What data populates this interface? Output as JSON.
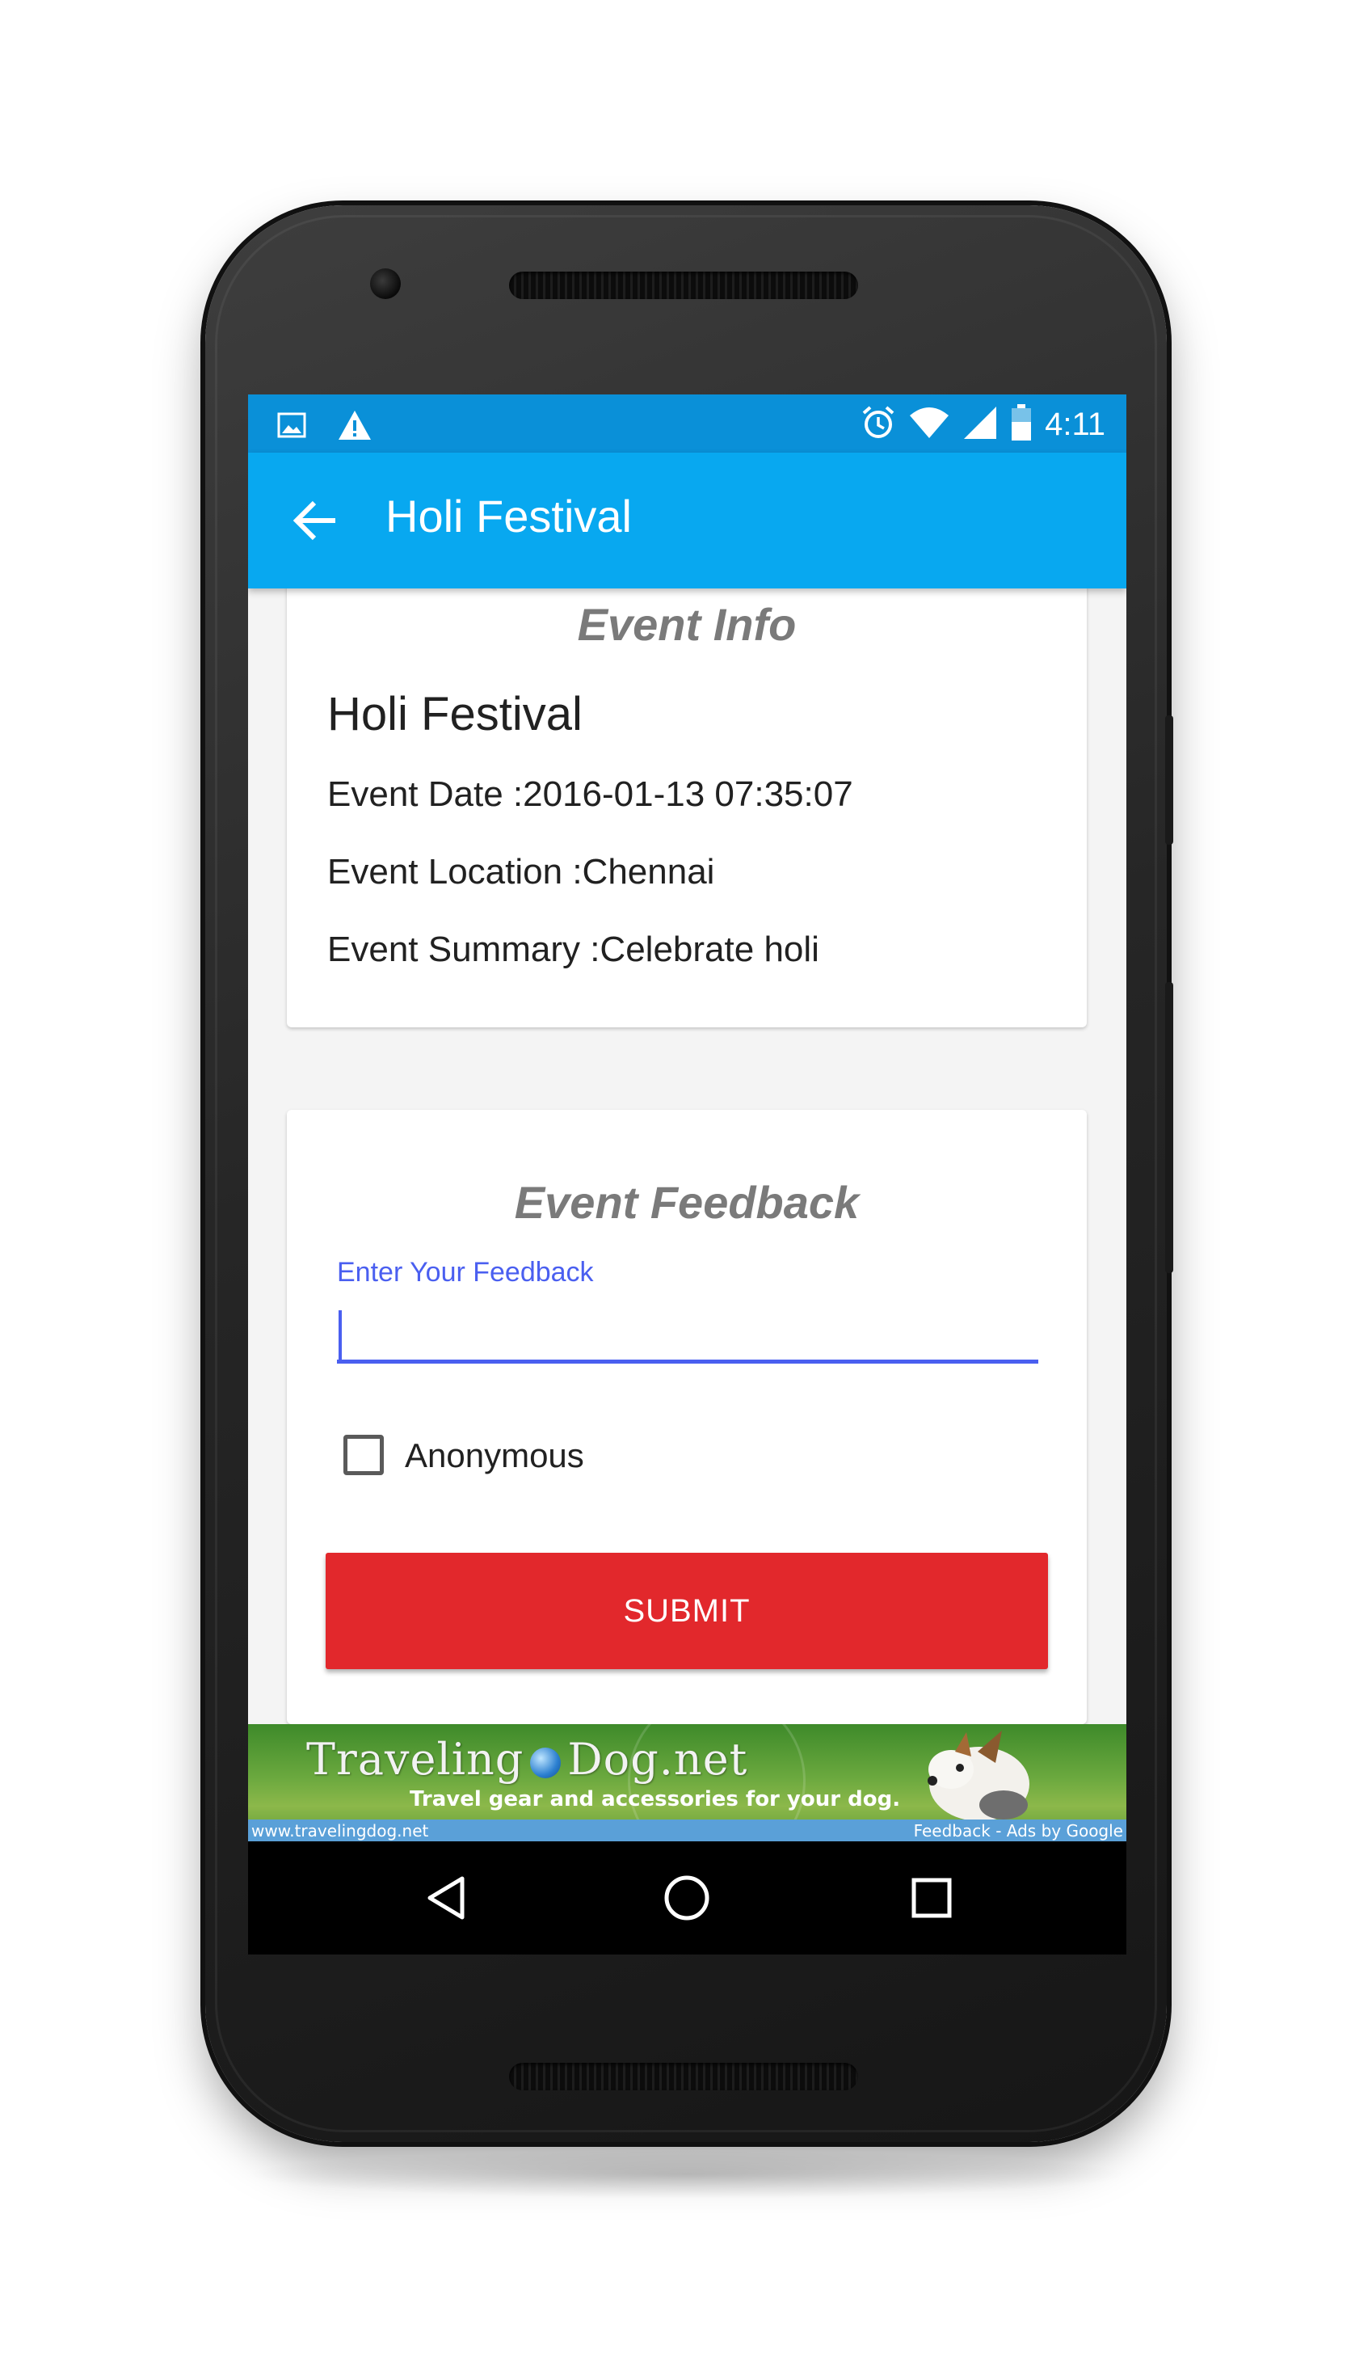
{
  "status_bar": {
    "time": "4:11",
    "icons": [
      "image-icon",
      "warning-icon",
      "alarm-icon",
      "wifi-icon",
      "signal-icon",
      "battery-icon"
    ]
  },
  "toolbar": {
    "title": "Holi Festival",
    "back_icon": "arrow-back-icon"
  },
  "event_info": {
    "heading": "Event Info",
    "title": "Holi Festival",
    "date_line": "Event Date :2016-01-13 07:35:07",
    "location_line": "Event Location :Chennai",
    "summary_line": "Event Summary :Celebrate holi"
  },
  "event_feedback": {
    "heading": "Event Feedback",
    "input_label": "Enter Your Feedback",
    "input_value": "",
    "anonymous_label": "Anonymous",
    "anonymous_checked": false,
    "submit_label": "SUBMIT"
  },
  "ad_banner": {
    "brand_left": "Traveling",
    "brand_right": "Dog.net",
    "tagline": "Travel gear and accessories for your dog.",
    "url": "www.travelingdog.net",
    "credit": "Feedback - Ads by Google"
  },
  "nav_bar": {
    "icons": [
      "nav-back-icon",
      "nav-home-icon",
      "nav-recents-icon"
    ]
  },
  "colors": {
    "status_bar": "#0a90d8",
    "toolbar": "#08a8f0",
    "accent": "#4a5ff0",
    "submit": "#e2282c"
  }
}
